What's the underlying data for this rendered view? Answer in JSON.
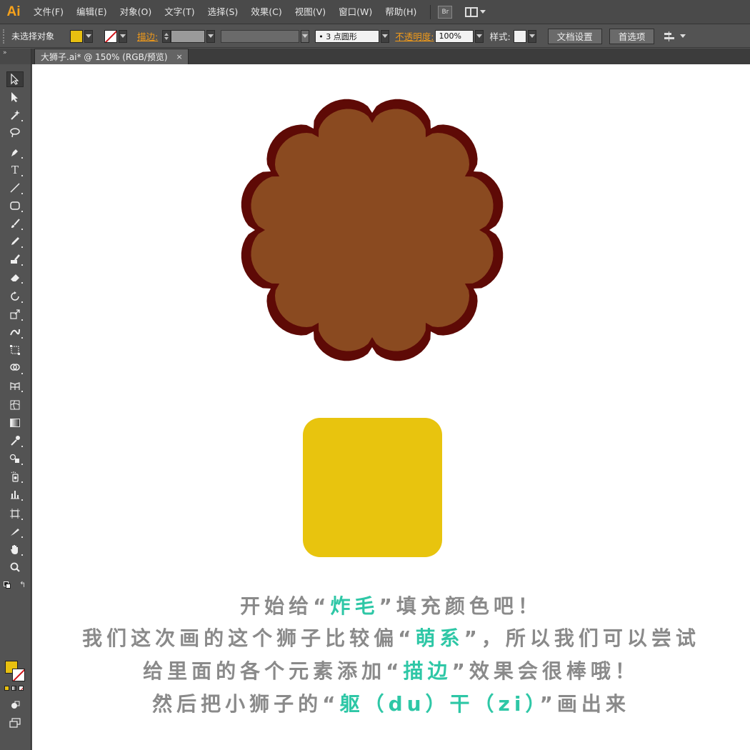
{
  "app": {
    "logo": "Ai",
    "menus": [
      "文件(F)",
      "编辑(E)",
      "对象(O)",
      "文字(T)",
      "选择(S)",
      "效果(C)",
      "视图(V)",
      "窗口(W)",
      "帮助(H)"
    ],
    "bridge_label": "Br"
  },
  "control": {
    "selection_label": "未选择对象",
    "stroke_label": "描边:",
    "brush_value": "• 3 点圆形",
    "opacity_label": "不透明度:",
    "opacity_value": "100%",
    "style_label": "样式:",
    "doc_setup_button": "文档设置",
    "prefs_button": "首选项"
  },
  "tab": {
    "title": "大狮子.ai* @ 150% (RGB/预览)",
    "close": "×"
  },
  "colors": {
    "fill": "#e8c010",
    "mane_fill": "#8a4a20",
    "mane_stroke": "#5e0a06",
    "square": "#e8c40e",
    "highlight": "#2ec7a6",
    "caption": "#8a8a8a"
  },
  "caption": {
    "line1": {
      "a": "开始给“",
      "b": "炸毛",
      "c": "”填充颜色吧！"
    },
    "line2": {
      "a": "我们这次画的这个狮子比较偏“",
      "b": "萌系",
      "c": "”，所以我们可以尝试"
    },
    "line3": {
      "a": "给里面的各个元素添加“",
      "b": "描边",
      "c": "”效果会很棒哦！"
    },
    "line4": {
      "a": "然后把小狮子的“",
      "b": "躯（du）干（zi）",
      "c": "”画出来"
    }
  }
}
